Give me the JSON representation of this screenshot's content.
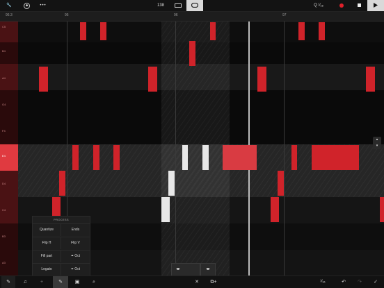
{
  "topbar": {
    "tempo": "138",
    "quantize": "Q ¹⁄₁₆",
    "more_label": "•••"
  },
  "ruler": {
    "position": "96.3",
    "markers": [
      "95",
      "96",
      "97"
    ]
  },
  "keys": {
    "labels": [
      "C5",
      "B4",
      "A4",
      "G4",
      "F4",
      "E4",
      "D4",
      "C4",
      "B3",
      "A3"
    ]
  },
  "process_panel": {
    "title": "PROCESS",
    "buttons": [
      "Quantize",
      "Ends",
      "Flip H",
      "Flip V",
      "Fill part",
      "⏶ Oct",
      "Legato",
      "⏷ Oct"
    ]
  },
  "bottombar": {
    "grid_value": "¹⁄₁₆"
  },
  "colors": {
    "note_red": "#d0232a",
    "note_selected": "#e8e8e8",
    "record": "#e0202a"
  }
}
